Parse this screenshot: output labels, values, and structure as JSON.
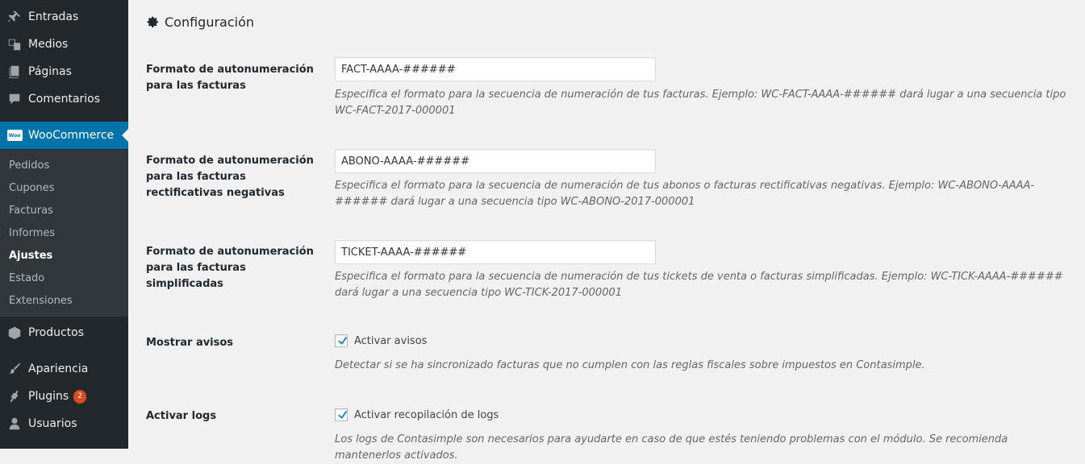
{
  "sidebar": {
    "top_items": [
      {
        "label": "Entradas",
        "icon": "pin-icon"
      },
      {
        "label": "Medios",
        "icon": "media-icon"
      },
      {
        "label": "Páginas",
        "icon": "pages-icon"
      },
      {
        "label": "Comentarios",
        "icon": "comments-icon"
      }
    ],
    "woocommerce": {
      "label": "WooCommerce",
      "icon_text": "Woo"
    },
    "submenu": [
      "Pedidos",
      "Cupones",
      "Facturas",
      "Informes",
      "Ajustes",
      "Estado",
      "Extensiones"
    ],
    "bottom_items": [
      {
        "label": "Productos",
        "icon": "box-icon"
      },
      {
        "label": "Apariencia",
        "icon": "brush-icon"
      },
      {
        "label": "Plugins",
        "icon": "plugin-icon",
        "badge": "2"
      },
      {
        "label": "Usuarios",
        "icon": "users-icon"
      }
    ]
  },
  "main": {
    "title": "Configuración",
    "fields": [
      {
        "label": "Formato de autonumeración para las facturas",
        "value": "FACT-AAAA-######",
        "description": "Especifica el formato para la secuencia de numeración de tus facturas. Ejemplo: WC-FACT-AAAA-###### dará lugar a una secuencia tipo WC-FACT-2017-000001"
      },
      {
        "label": "Formato de autonumeración para las facturas rectificativas negativas",
        "value": "ABONO-AAAA-######",
        "description": "Especifica el formato para la secuencia de numeración de tus abonos o facturas rectificativas negativas. Ejemplo: WC-ABONO-AAAA-###### dará lugar a una secuencia tipo WC-ABONO-2017-000001"
      },
      {
        "label": "Formato de autonumeración para las facturas simplificadas",
        "value": "TICKET-AAAA-######",
        "description": "Especifica el formato para la secuencia de numeración de tus tickets de venta o facturas simplificadas. Ejemplo: WC-TICK-AAAA-###### dará lugar a una secuencia tipo WC-TICK-2017-000001"
      }
    ],
    "checks": [
      {
        "label": "Mostrar avisos",
        "checkbox_label": "Activar avisos",
        "checked": true,
        "description": "Detectar si se ha sincronizado facturas que no cumplen con las reglas fiscales sobre impuestos en Contasimple."
      },
      {
        "label": "Activar logs",
        "checkbox_label": "Activar recopilación de logs",
        "checked": true,
        "description": "Los logs de Contasimple son necesarios para ayudarte en caso de que estés teniendo problemas con el módulo. Se recomienda mantenerlos activados."
      }
    ]
  },
  "colors": {
    "sidebar_bg": "#23282d",
    "submenu_bg": "#32373c",
    "accent": "#0073aa",
    "badge": "#d54e21",
    "page_bg": "#f1f1f1"
  }
}
